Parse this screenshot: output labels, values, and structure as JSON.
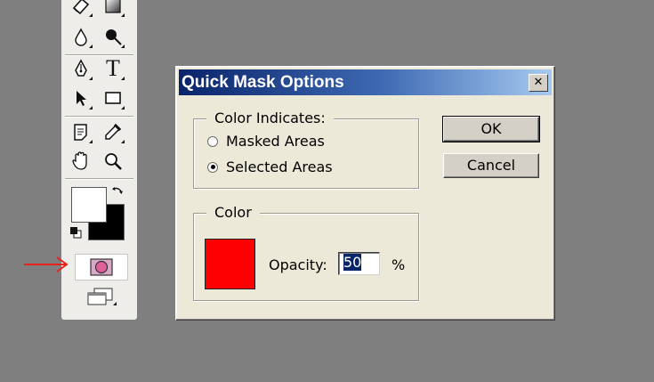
{
  "toolbox": {
    "tools": [
      {
        "name": "eraser-icon",
        "flyout": true
      },
      {
        "name": "gradient-icon",
        "flyout": true
      },
      {
        "name": "blur-icon",
        "flyout": true
      },
      {
        "name": "dodge-icon",
        "flyout": true
      },
      {
        "name": "pen-icon",
        "flyout": true
      },
      {
        "name": "type-icon",
        "flyout": true
      },
      {
        "name": "path-selection-icon",
        "flyout": true
      },
      {
        "name": "rectangle-shape-icon",
        "flyout": true
      },
      {
        "name": "notes-icon",
        "flyout": true
      },
      {
        "name": "eyedropper-icon",
        "flyout": true
      },
      {
        "name": "hand-icon",
        "flyout": false
      },
      {
        "name": "zoom-icon",
        "flyout": false
      }
    ],
    "type_tool_glyph": "T",
    "foreground_color": "#ffffff",
    "background_color": "#000000",
    "quick_mask_icon": "quick-mask-icon",
    "annotation_arrow_color": "#e8231b"
  },
  "dialog": {
    "title": "Quick Mask Options",
    "close_glyph": "✕",
    "indicates_group": {
      "legend": "Color Indicates:",
      "options": [
        {
          "label": "Masked Areas",
          "selected": false
        },
        {
          "label": "Selected Areas",
          "selected": true
        }
      ]
    },
    "color_group": {
      "legend": "Color",
      "swatch_color": "#ff0000",
      "opacity_label": "Opacity:",
      "opacity_value": "50",
      "percent_label": "%"
    },
    "ok_label": "OK",
    "cancel_label": "Cancel"
  }
}
